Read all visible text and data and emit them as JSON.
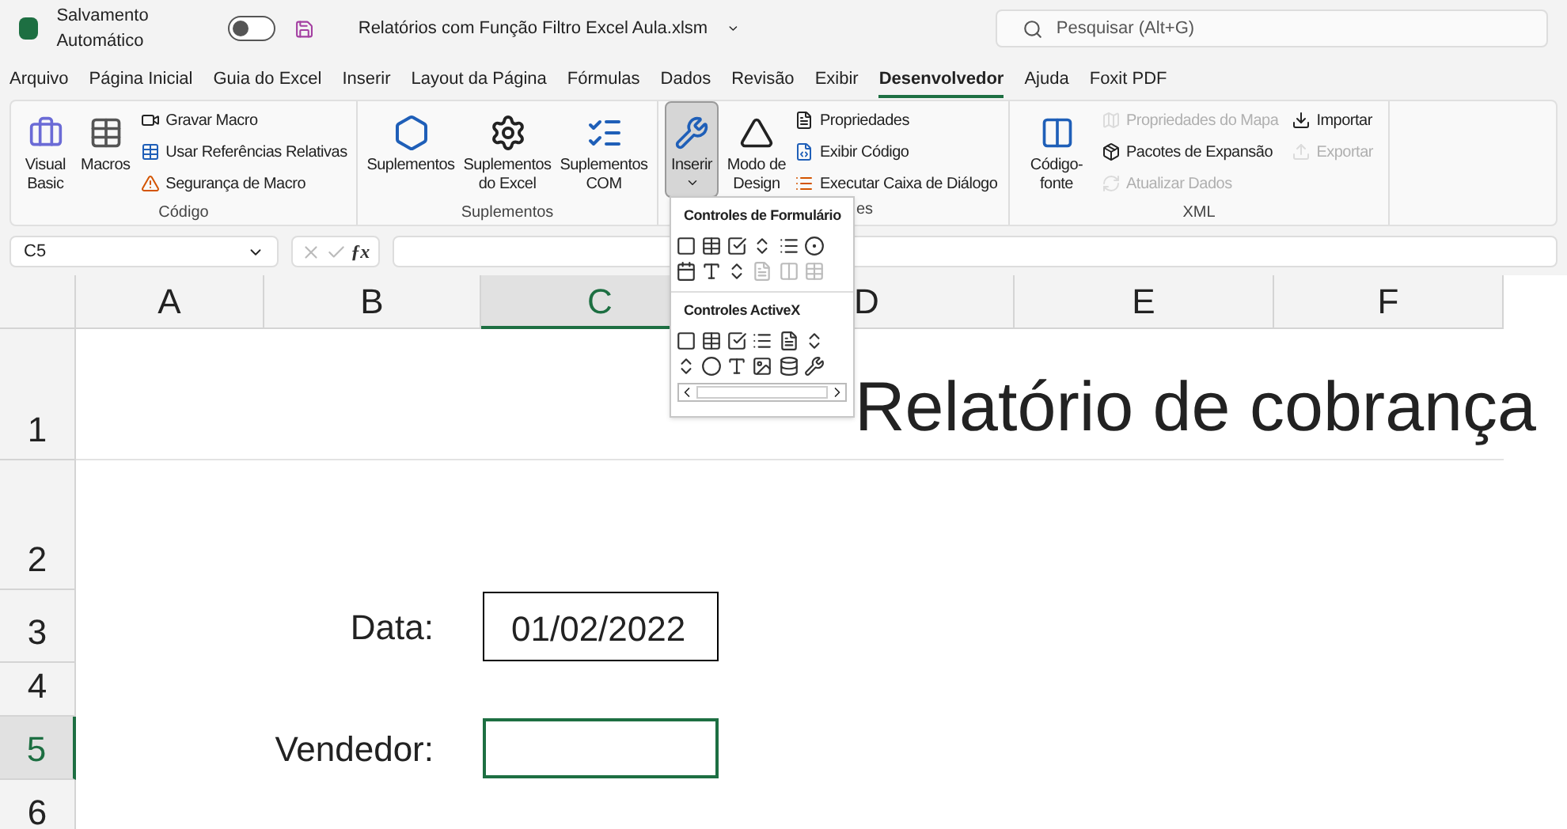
{
  "title_bar": {
    "autosave_label": "Salvamento Automático",
    "autosave_on": false,
    "file_name": "Relatórios com Função Filtro Excel Aula.xlsm",
    "search_placeholder": "Pesquisar (Alt+G)"
  },
  "menu_tabs": [
    {
      "label": "Arquivo",
      "selected": false
    },
    {
      "label": "Página Inicial",
      "selected": false
    },
    {
      "label": "Guia do Excel",
      "selected": false
    },
    {
      "label": "Inserir",
      "selected": false
    },
    {
      "label": "Layout da Página",
      "selected": false
    },
    {
      "label": "Fórmulas",
      "selected": false
    },
    {
      "label": "Dados",
      "selected": false
    },
    {
      "label": "Revisão",
      "selected": false
    },
    {
      "label": "Exibir",
      "selected": false
    },
    {
      "label": "Desenvolvedor",
      "selected": true
    },
    {
      "label": "Ajuda",
      "selected": false
    },
    {
      "label": "Foxit PDF",
      "selected": false
    }
  ],
  "ribbon": {
    "codigo": {
      "large": [
        {
          "label": "Visual Basic"
        },
        {
          "label": "Macros"
        }
      ],
      "small": [
        {
          "label": "Gravar Macro"
        },
        {
          "label": "Usar Referências Relativas"
        },
        {
          "label": "Segurança de Macro"
        }
      ],
      "title": "Código"
    },
    "suplementos": {
      "large": [
        {
          "label": "Suplementos"
        },
        {
          "label": "Suplementos do Excel"
        },
        {
          "label": "Suplementos COM"
        }
      ],
      "title": "Suplementos"
    },
    "controles": {
      "large": [
        {
          "label": "Inserir",
          "pressed": true
        },
        {
          "label": "Modo de Design",
          "pressed": false
        }
      ],
      "small": [
        {
          "label": "Propriedades"
        },
        {
          "label": "Exibir Código"
        },
        {
          "label": "Executar Caixa de Diálogo"
        }
      ],
      "title_visible": "es"
    },
    "xml": {
      "large": [
        {
          "label": "Código-fonte"
        }
      ],
      "small": [
        {
          "label": "Propriedades do Mapa",
          "disabled": true
        },
        {
          "label": "Pacotes de Expansão",
          "disabled": false
        },
        {
          "label": "Atualizar Dados",
          "disabled": true
        }
      ],
      "small2": [
        {
          "label": "Importar",
          "disabled": false
        },
        {
          "label": "Exportar",
          "disabled": true
        }
      ],
      "title": "XML"
    }
  },
  "name_box": "C5",
  "fx_label": "ƒx",
  "columns": [
    {
      "label": "A",
      "selected": false
    },
    {
      "label": "B",
      "selected": false
    },
    {
      "label": "C",
      "selected": true
    },
    {
      "label": "D",
      "selected": false
    },
    {
      "label": "E",
      "selected": false
    },
    {
      "label": "F",
      "selected": false
    }
  ],
  "rows": [
    {
      "label": "1",
      "selected": false
    },
    {
      "label": "2",
      "selected": false
    },
    {
      "label": "3",
      "selected": false
    },
    {
      "label": "4",
      "selected": false
    },
    {
      "label": "5",
      "selected": true
    },
    {
      "label": "6",
      "selected": false
    }
  ],
  "cells": {
    "title": "Relatório de cobrança",
    "date_label": "Data:",
    "date_value": "01/02/2022",
    "seller_label": "Vendedor:"
  },
  "insert_menu": {
    "sections": [
      {
        "title": "Controles de Formulário"
      },
      {
        "title": "Controles ActiveX"
      }
    ]
  }
}
